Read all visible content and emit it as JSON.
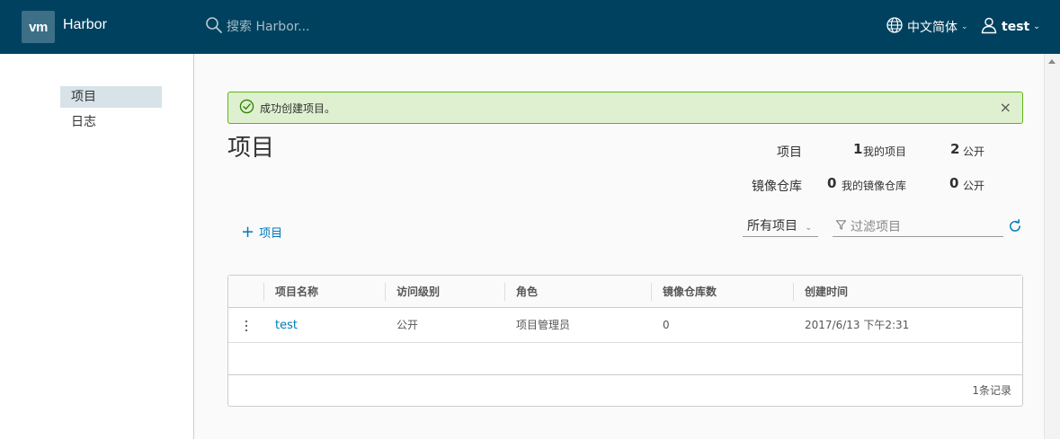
{
  "header": {
    "logo_text": "vm",
    "app_name": "Harbor",
    "search_placeholder": "搜索 Harbor...",
    "language": "中文简体",
    "username": "test",
    "colors": {
      "bar": "#00415f",
      "logo_box": "#3d6f87"
    }
  },
  "sidebar": {
    "items": [
      {
        "label": "项目",
        "active": true
      },
      {
        "label": "日志",
        "active": false
      }
    ]
  },
  "alert": {
    "message": "成功创建项目。",
    "close_glyph": "×",
    "colors": {
      "bg": "#dff0d0",
      "border": "#60b515"
    }
  },
  "page": {
    "title": "项目"
  },
  "stats": {
    "projects_label": "项目",
    "my_projects_count": "1",
    "my_projects_label": "我的项目",
    "public_projects_count": "2",
    "public_label": "公开",
    "repos_label": "镜像仓库",
    "my_repos_count": "0",
    "my_repos_label": "我的镜像仓库",
    "public_repos_count": "0",
    "public_repos_label": "公开"
  },
  "toolbar": {
    "add_label": "项目",
    "filter_select": "所有项目",
    "filter_placeholder": "过滤项目"
  },
  "table": {
    "columns": [
      "项目名称",
      "访问级别",
      "角色",
      "镜像仓库数",
      "创建时间"
    ],
    "rows": [
      {
        "name": "test",
        "access": "公开",
        "role": "项目管理员",
        "repo_count": "0",
        "created": "2017/6/13 下午2:31"
      }
    ],
    "footer": "1条记录"
  },
  "icons": [
    "search-icon",
    "globe-icon",
    "user-icon",
    "check-circle-icon",
    "close-icon",
    "plus-icon",
    "filter-icon",
    "refresh-icon",
    "kebab-icon"
  ],
  "accent_color": "#0079b8"
}
